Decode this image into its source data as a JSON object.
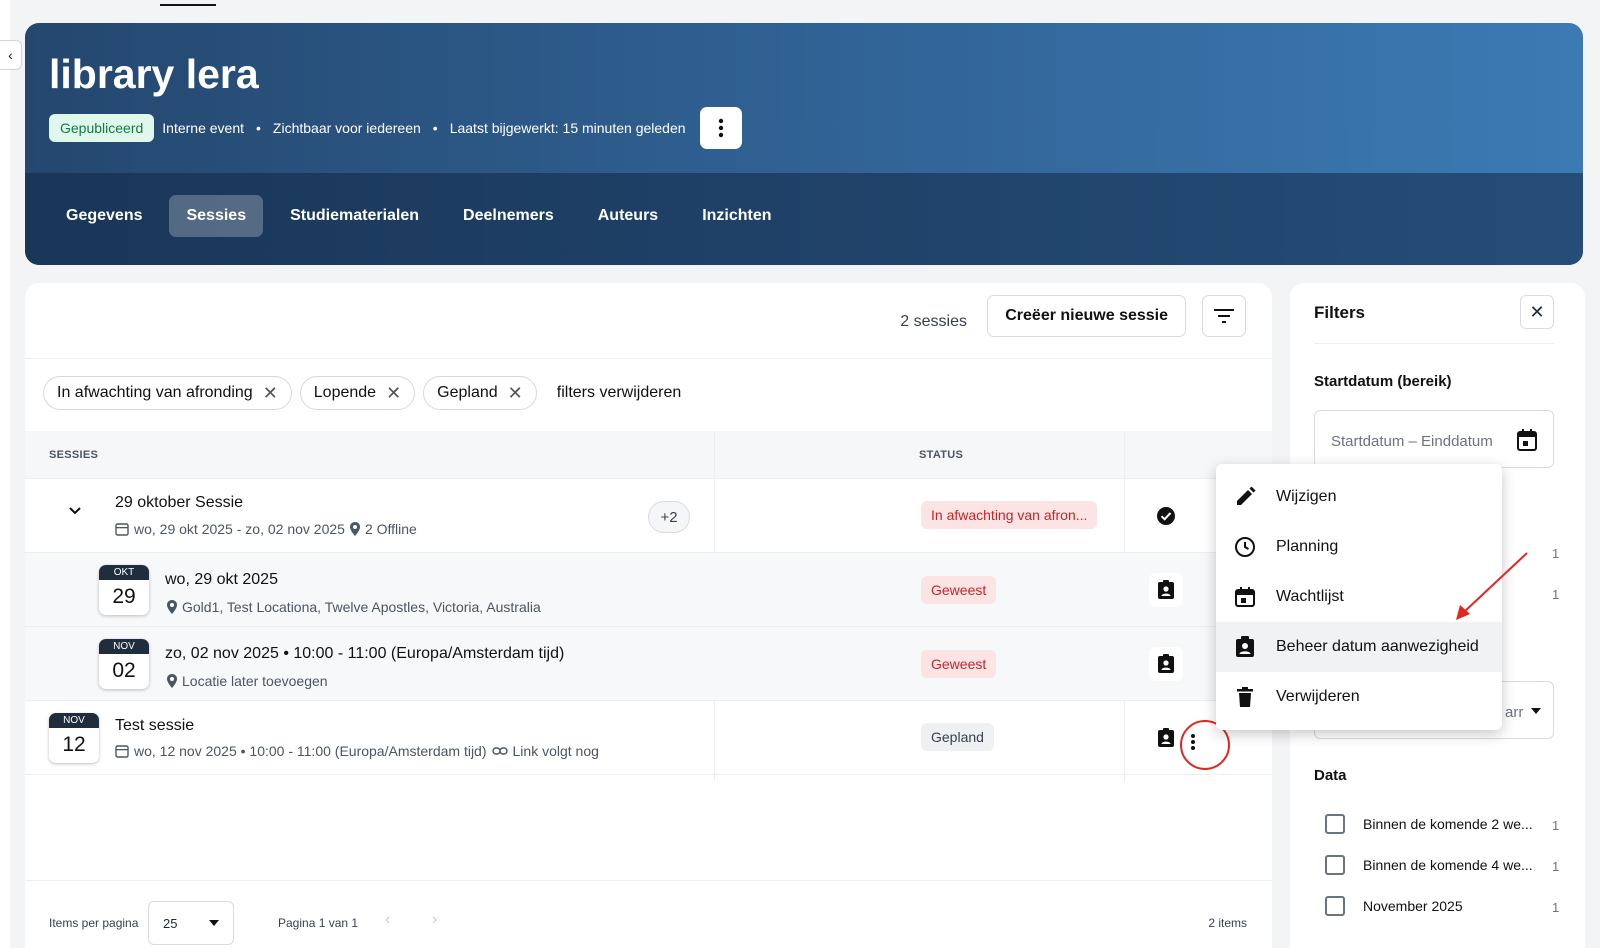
{
  "header": {
    "title": "library lera",
    "badge": "Gepubliceerd",
    "meta": [
      "Interne event",
      "Zichtbaar voor iedereen",
      "Laatst bijgewerkt: 15 minuten geleden"
    ],
    "separator": "•",
    "tabs": [
      {
        "label": "Gegevens",
        "active": false
      },
      {
        "label": "Sessies",
        "active": true
      },
      {
        "label": "Studiematerialen",
        "active": false
      },
      {
        "label": "Deelnemers",
        "active": false
      },
      {
        "label": "Auteurs",
        "active": false
      },
      {
        "label": "Inzichten",
        "active": false
      }
    ]
  },
  "toolbar": {
    "session_count": "2 sessies",
    "create_label": "Creëer nieuwe sessie"
  },
  "chips": [
    {
      "label": "In afwachting van afronding"
    },
    {
      "label": "Lopende"
    },
    {
      "label": "Gepland"
    }
  ],
  "chip_close_glyph": "✕",
  "clear_filters": "filters verwijderen",
  "table": {
    "headers": {
      "sessions": "SESSIES",
      "status": "STATUS"
    },
    "rows": [
      {
        "title": "29 oktober Sessie",
        "dates": "wo, 29 okt 2025 - zo, 02 nov 2025",
        "location": "2 Offline",
        "extra": "+2",
        "status": "In afwachting van afron..."
      },
      {
        "month": "OKT",
        "day": "29",
        "title": "wo, 29 okt 2025",
        "location": "Gold1, Test Locationa, Twelve Apostles, Victoria, Australia",
        "status": "Geweest"
      },
      {
        "month": "NOV",
        "day": "02",
        "title": "zo, 02 nov 2025 • 10:00 - 11:00 (Europa/Amsterdam tijd)",
        "location": "Locatie later toevoegen",
        "status": "Geweest"
      },
      {
        "month": "NOV",
        "day": "12",
        "title": "Test sessie",
        "dates": "wo, 12 nov 2025 • 10:00 - 11:00 (Europa/Amsterdam tijd)",
        "link": "Link volgt nog",
        "status": "Gepland"
      }
    ]
  },
  "footer": {
    "per_page_label": "Items per pagina",
    "per_page_value": "25",
    "page_label": "Pagina 1 van 1",
    "items_count": "2 items",
    "prev": "‹",
    "next": "›"
  },
  "filters": {
    "title": "Filters",
    "close": "✕",
    "start_section": "Startdatum (bereik)",
    "date_placeholder": "Startdatum – Einddatum",
    "counts": [
      "1",
      "1"
    ],
    "hidden_select_text": "arr",
    "data_section": "Data",
    "checkboxes": [
      {
        "label": "Binnen de komende 2 we...",
        "count": "1"
      },
      {
        "label": "Binnen de komende 4 we...",
        "count": "1"
      },
      {
        "label": "November 2025",
        "count": "1"
      }
    ]
  },
  "menu": {
    "items": [
      {
        "label": "Wijzigen",
        "icon": "pencil-icon"
      },
      {
        "label": "Planning",
        "icon": "clock-icon"
      },
      {
        "label": "Wachtlijst",
        "icon": "calendar-icon"
      },
      {
        "label": "Beheer datum aanwezigheid",
        "icon": "clipboard-person-icon",
        "highlighted": true
      },
      {
        "label": "Verwijderen",
        "icon": "trash-icon"
      }
    ]
  },
  "colors": {
    "accent_red": "#e3261e",
    "status_red_bg": "#fde4e4",
    "published_green": "#0f7a45"
  }
}
